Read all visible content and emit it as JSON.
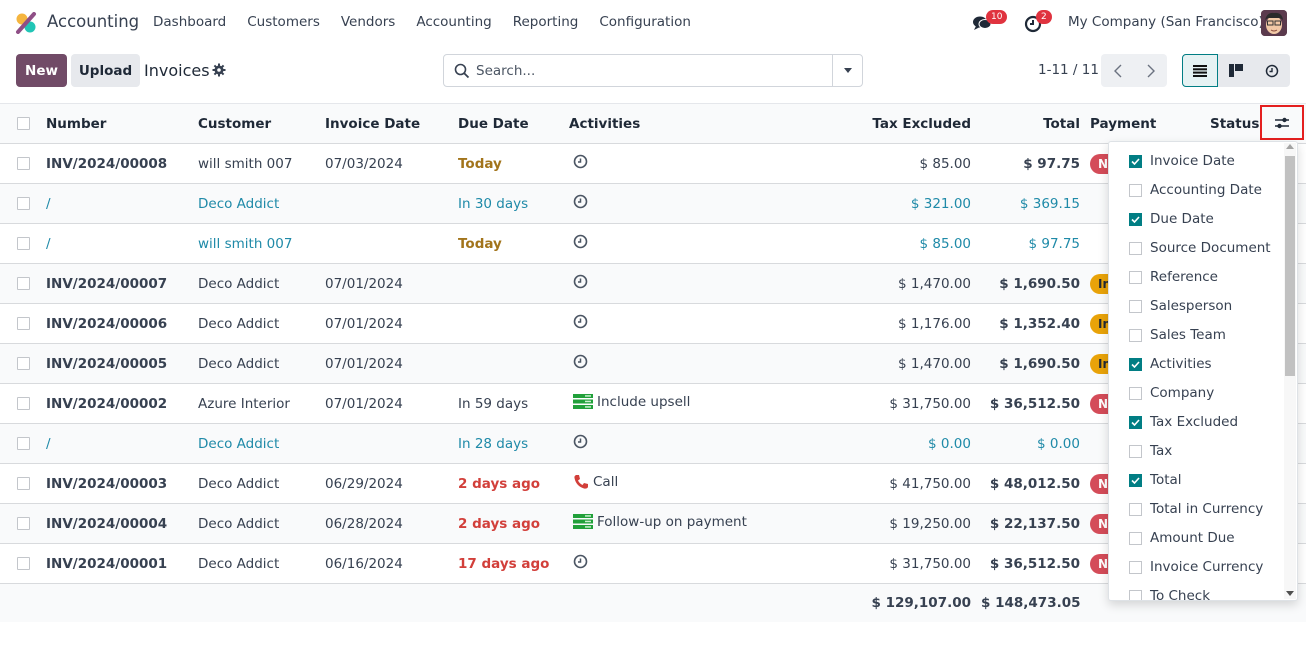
{
  "navbar": {
    "app_name": "Accounting",
    "menu": [
      "Dashboard",
      "Customers",
      "Vendors",
      "Accounting",
      "Reporting",
      "Configuration"
    ],
    "messages_count": "10",
    "activities_count": "2",
    "company": "My Company (San Francisco)"
  },
  "control_panel": {
    "new_label": "New",
    "upload_label": "Upload",
    "title": "Invoices",
    "search_placeholder": "Search...",
    "search_value": "",
    "pager": "1-11 / 11",
    "views": [
      "list-view",
      "kanban-view",
      "activity-view"
    ],
    "active_view": "list-view"
  },
  "table": {
    "headers": {
      "number": "Number",
      "customer": "Customer",
      "invoice_date": "Invoice Date",
      "due_date": "Due Date",
      "activities": "Activities",
      "tax_excluded": "Tax Excluded",
      "total": "Total",
      "payment": "Payment",
      "status": "Status"
    },
    "rows": [
      {
        "number": "INV/2024/00008",
        "customer": "will smith 007",
        "invoice_date": "07/03/2024",
        "due_date": "Today",
        "due_state": "today",
        "activity": "",
        "activity_icon": "clock-icon",
        "tax_excluded": "$ 85.00",
        "total": "$ 97.75",
        "payment": "Not Paid",
        "payment_state": "not",
        "draft": false
      },
      {
        "number": "/",
        "customer": "Deco Addict",
        "invoice_date": "",
        "due_date": "In 30 days",
        "due_state": "future",
        "activity": "",
        "activity_icon": "clock-icon",
        "tax_excluded": "$ 321.00",
        "total": "$ 369.15",
        "payment": "",
        "payment_state": "",
        "draft": true
      },
      {
        "number": "/",
        "customer": "will smith 007",
        "invoice_date": "",
        "due_date": "Today",
        "due_state": "today",
        "activity": "",
        "activity_icon": "clock-icon",
        "tax_excluded": "$ 85.00",
        "total": "$ 97.75",
        "payment": "",
        "payment_state": "",
        "draft": true
      },
      {
        "number": "INV/2024/00007",
        "customer": "Deco Addict",
        "invoice_date": "07/01/2024",
        "due_date": "",
        "due_state": "",
        "activity": "",
        "activity_icon": "clock-icon",
        "tax_excluded": "$ 1,470.00",
        "total": "$ 1,690.50",
        "payment": "In Payment",
        "payment_state": "partial",
        "draft": false
      },
      {
        "number": "INV/2024/00006",
        "customer": "Deco Addict",
        "invoice_date": "07/01/2024",
        "due_date": "",
        "due_state": "",
        "activity": "",
        "activity_icon": "clock-icon",
        "tax_excluded": "$ 1,176.00",
        "total": "$ 1,352.40",
        "payment": "In Payment",
        "payment_state": "partial",
        "draft": false
      },
      {
        "number": "INV/2024/00005",
        "customer": "Deco Addict",
        "invoice_date": "07/01/2024",
        "due_date": "",
        "due_state": "",
        "activity": "",
        "activity_icon": "clock-icon",
        "tax_excluded": "$ 1,470.00",
        "total": "$ 1,690.50",
        "payment": "In Payment",
        "payment_state": "partial",
        "draft": false
      },
      {
        "number": "INV/2024/00002",
        "customer": "Azure Interior",
        "invoice_date": "07/01/2024",
        "due_date": "In 59 days",
        "due_state": "plain",
        "activity": "Include upsell",
        "activity_icon": "todo-icon",
        "tax_excluded": "$ 31,750.00",
        "total": "$ 36,512.50",
        "payment": "Not Paid",
        "payment_state": "not",
        "draft": false
      },
      {
        "number": "/",
        "customer": "Deco Addict",
        "invoice_date": "",
        "due_date": "In 28 days",
        "due_state": "future",
        "activity": "",
        "activity_icon": "clock-icon",
        "tax_excluded": "$ 0.00",
        "total": "$ 0.00",
        "payment": "",
        "payment_state": "",
        "draft": true
      },
      {
        "number": "INV/2024/00003",
        "customer": "Deco Addict",
        "invoice_date": "06/29/2024",
        "due_date": "2 days ago",
        "due_state": "late",
        "activity": "Call",
        "activity_icon": "phone-icon",
        "tax_excluded": "$ 41,750.00",
        "total": "$ 48,012.50",
        "payment": "Not Paid",
        "payment_state": "not",
        "draft": false
      },
      {
        "number": "INV/2024/00004",
        "customer": "Deco Addict",
        "invoice_date": "06/28/2024",
        "due_date": "2 days ago",
        "due_state": "late",
        "activity": "Follow-up on payment",
        "activity_icon": "todo-icon",
        "tax_excluded": "$ 19,250.00",
        "total": "$ 22,137.50",
        "payment": "Not Paid",
        "payment_state": "not",
        "draft": false
      },
      {
        "number": "INV/2024/00001",
        "customer": "Deco Addict",
        "invoice_date": "06/16/2024",
        "due_date": "17 days ago",
        "due_state": "late",
        "activity": "",
        "activity_icon": "clock-icon",
        "tax_excluded": "$ 31,750.00",
        "total": "$ 36,512.50",
        "payment": "Not Paid",
        "payment_state": "not",
        "draft": false
      }
    ],
    "footer": {
      "tax_excluded": "$ 129,107.00",
      "total": "$ 148,473.05"
    }
  },
  "optional_columns": [
    {
      "label": "Invoice Date",
      "checked": true
    },
    {
      "label": "Accounting Date",
      "checked": false
    },
    {
      "label": "Due Date",
      "checked": true
    },
    {
      "label": "Source Document",
      "checked": false
    },
    {
      "label": "Reference",
      "checked": false
    },
    {
      "label": "Salesperson",
      "checked": false
    },
    {
      "label": "Sales Team",
      "checked": false
    },
    {
      "label": "Activities",
      "checked": true
    },
    {
      "label": "Company",
      "checked": false
    },
    {
      "label": "Tax Excluded",
      "checked": true
    },
    {
      "label": "Tax",
      "checked": false
    },
    {
      "label": "Total",
      "checked": true
    },
    {
      "label": "Total in Currency",
      "checked": false
    },
    {
      "label": "Amount Due",
      "checked": false
    },
    {
      "label": "Invoice Currency",
      "checked": false
    },
    {
      "label": "To Check",
      "checked": false
    }
  ],
  "colors": {
    "brand": "#714b67",
    "accent": "#017e84",
    "link": "#1f8aa8",
    "due_today": "#a2741b",
    "due_late": "#d23f3a",
    "badge_not_paid": "#d44c59",
    "badge_in_payment": "#e9a309",
    "highlight_box": "#e41f1f"
  }
}
